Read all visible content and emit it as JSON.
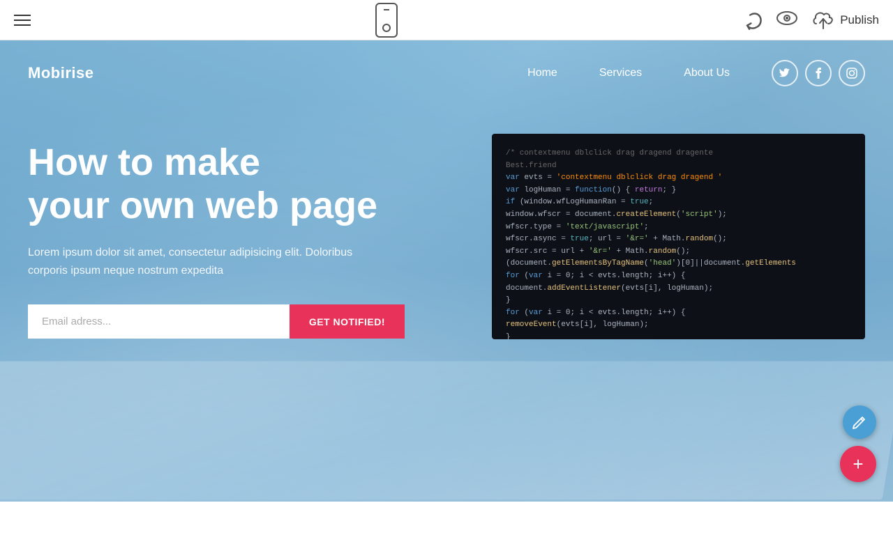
{
  "toolbar": {
    "publish_label": "Publish",
    "undo_symbol": "↩",
    "eye_symbol": "👁",
    "phone_label": "Mobile preview"
  },
  "site": {
    "logo": "Mobirise",
    "nav": {
      "home": "Home",
      "services": "Services",
      "about_us": "About Us"
    },
    "social": {
      "twitter": "𝕏",
      "facebook": "f",
      "instagram": "⬡"
    }
  },
  "hero": {
    "title_line1": "How to make",
    "title_line2": "your own web page",
    "subtitle": "Lorem ipsum dolor sit amet, consectetur adipisicing elit. Doloribus corporis ipsum neque nostrum expedita",
    "email_placeholder": "Email adress...",
    "cta_label": "GET NOTIFIED!"
  },
  "fab": {
    "edit_icon": "✏",
    "add_icon": "+"
  }
}
